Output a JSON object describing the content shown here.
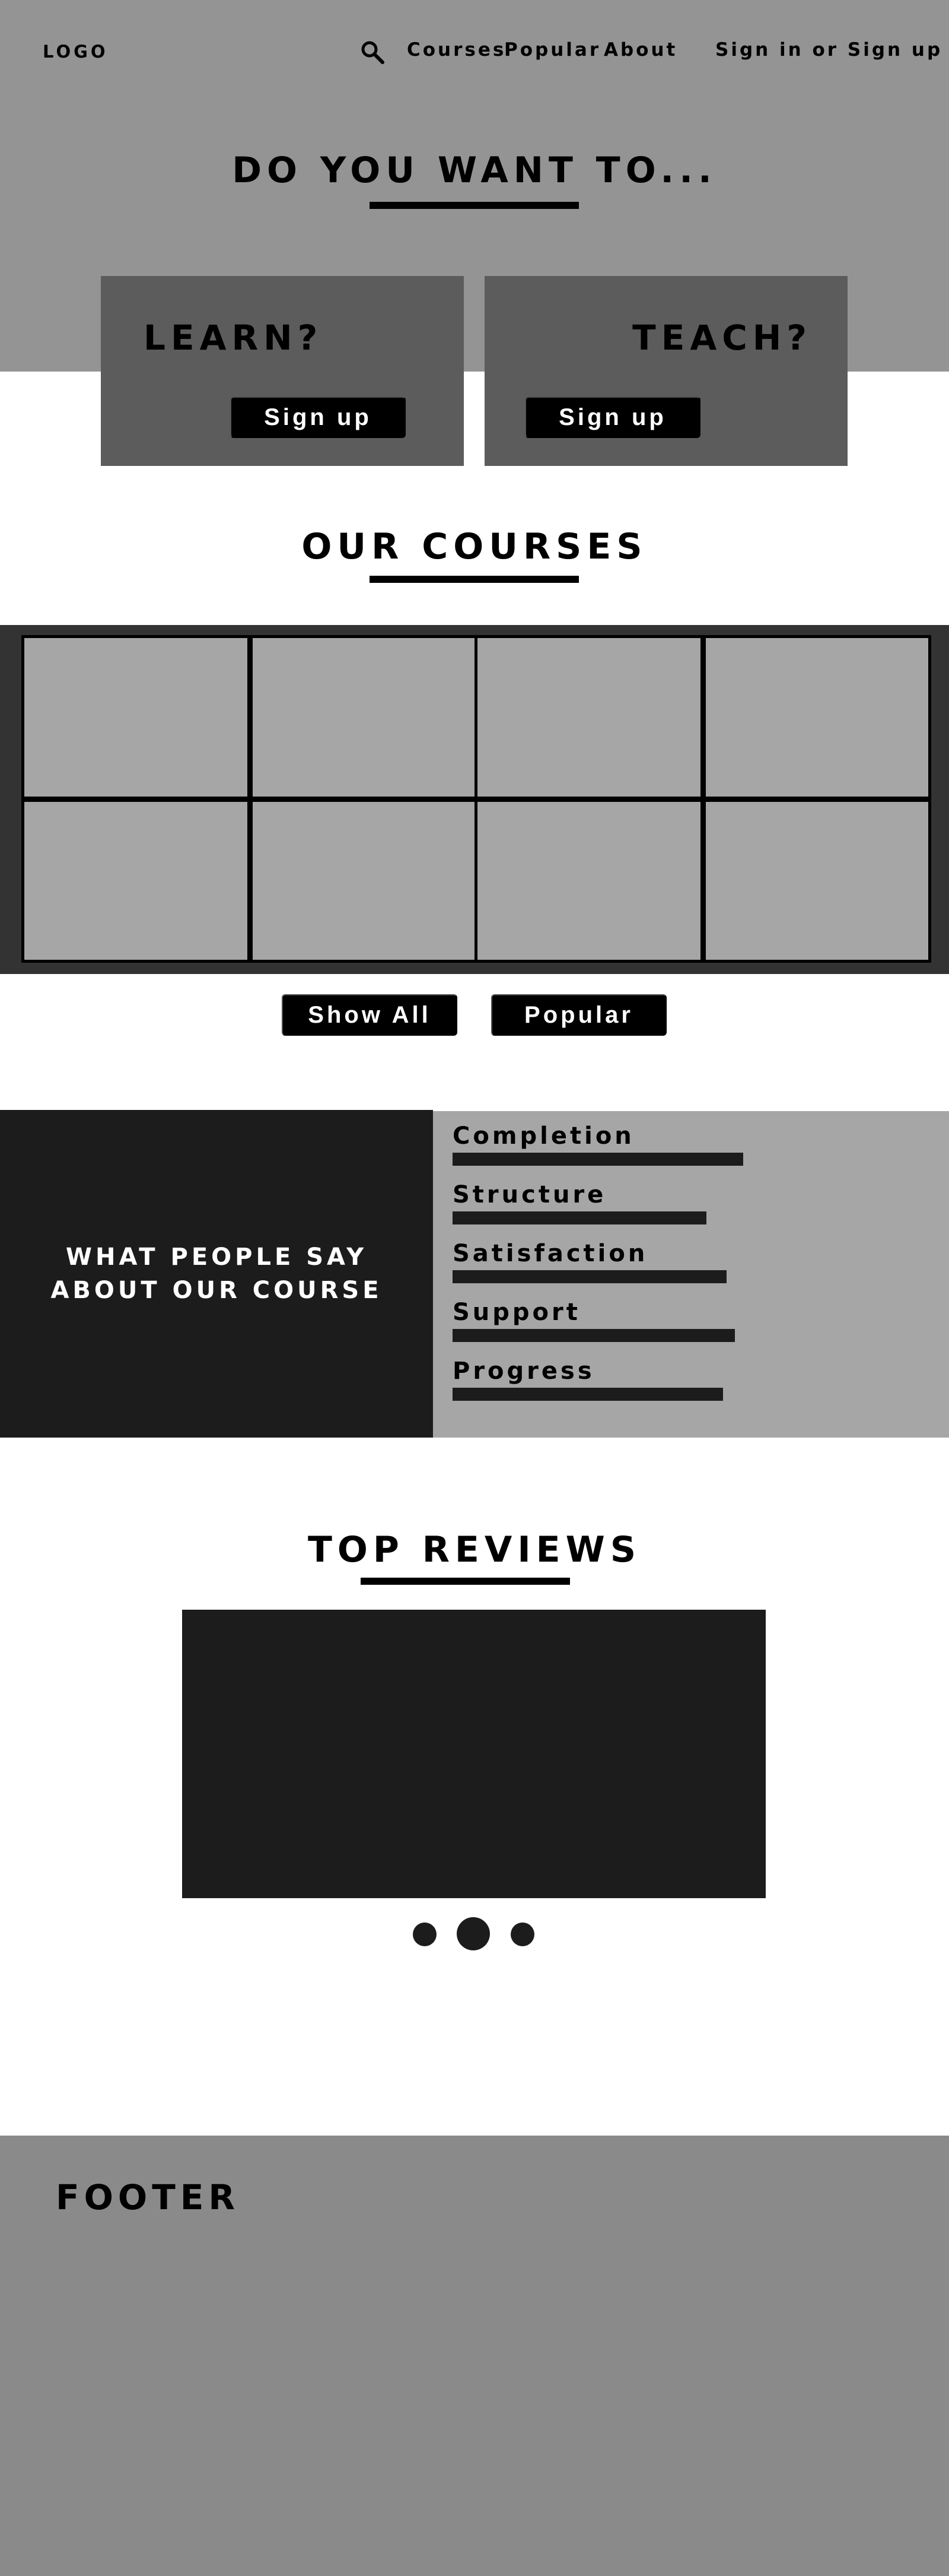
{
  "header": {
    "logo": "LOGO",
    "search_icon": "search-icon",
    "nav": {
      "courses": "Courses",
      "popular": "Popular",
      "about": "About"
    },
    "auth": "Sign in or Sign up"
  },
  "hero": {
    "title": "DO YOU WANT TO...",
    "learn": {
      "label": "LEARN?",
      "button": "Sign up"
    },
    "teach": {
      "label": "TEACH?",
      "button": "Sign up"
    }
  },
  "courses": {
    "title": "OUR COURSES",
    "show_all": "Show All",
    "popular": "Popular"
  },
  "feedback": {
    "heading": "WHAT PEOPLE SAY ABOUT OUR COURSE",
    "metrics": [
      {
        "label": "Completion",
        "level": 0.72
      },
      {
        "label": "Structure",
        "level": 0.63
      },
      {
        "label": "Satisfaction",
        "level": 0.68
      },
      {
        "label": "Support",
        "level": 0.7
      },
      {
        "label": "Progress",
        "level": 0.67
      }
    ]
  },
  "reviews": {
    "title": "TOP REVIEWS",
    "active_slide": 2,
    "slide_count": 3
  },
  "footer": {
    "label": "FOOTER"
  },
  "colors": {
    "hero_bg": "#949494",
    "card_bg": "#5c5c5c",
    "tile_bg": "#a6a6a6",
    "dark": "#1c1c1c",
    "footer_bg": "#8a8a8a"
  }
}
